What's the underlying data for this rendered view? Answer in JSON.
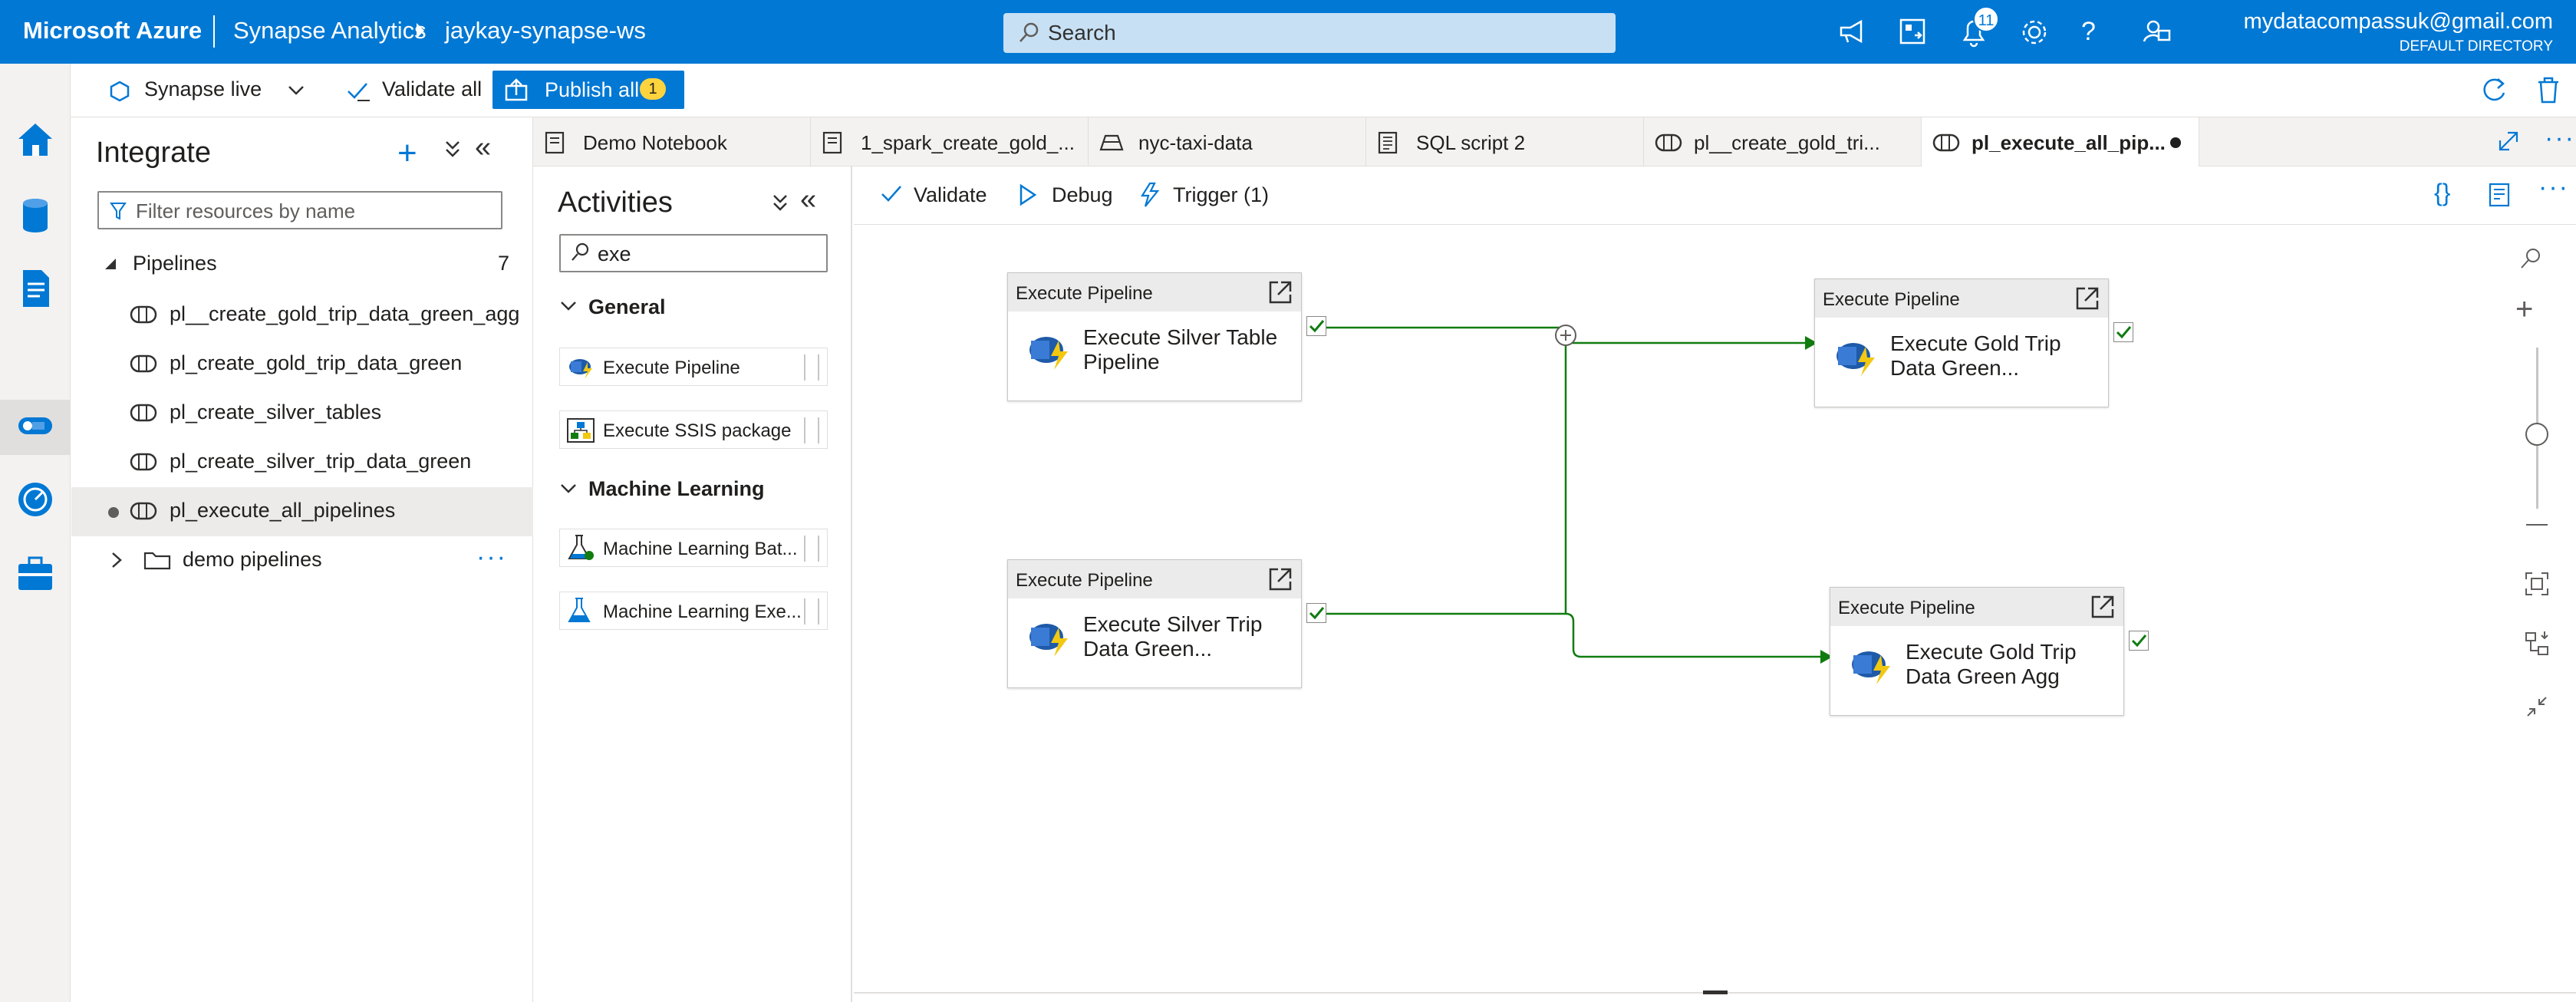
{
  "topbar": {
    "brand": "Microsoft Azure",
    "service": "Synapse Analytics",
    "workspace": "jaykay-synapse-ws",
    "search_placeholder": "Search",
    "notification_count": "11",
    "account_email": "mydatacompassuk@gmail.com",
    "directory": "DEFAULT DIRECTORY"
  },
  "commandbar": {
    "synapse_live": "Synapse live",
    "validate_all": "Validate all",
    "publish_all": "Publish all",
    "publish_count": "1"
  },
  "explorer": {
    "title": "Integrate",
    "filter_placeholder": "Filter resources by name",
    "section": "Pipelines",
    "section_count": "7",
    "pipelines": [
      "pl__create_gold_trip_data_green_agg",
      "pl_create_gold_trip_data_green",
      "pl_create_silver_tables",
      "pl_create_silver_trip_data_green",
      "pl_execute_all_pipelines"
    ],
    "folder": "demo pipelines"
  },
  "tabs": [
    {
      "label": "Demo Notebook",
      "icon": "notebook-icon"
    },
    {
      "label": "1_spark_create_gold_...",
      "icon": "notebook-icon"
    },
    {
      "label": "nyc-taxi-data",
      "icon": "dataset-icon"
    },
    {
      "label": "SQL script 2",
      "icon": "sql-script-icon"
    },
    {
      "label": "pl__create_gold_tri...",
      "icon": "pipeline-icon"
    },
    {
      "label": "pl_execute_all_pip...",
      "icon": "pipeline-icon"
    }
  ],
  "activities": {
    "title": "Activities",
    "search_value": "exe",
    "groups": [
      {
        "name": "General",
        "items": [
          "Execute Pipeline",
          "Execute SSIS package"
        ]
      },
      {
        "name": "Machine Learning",
        "items": [
          "Machine Learning Bat...",
          "Machine Learning Exe..."
        ]
      }
    ]
  },
  "canvas_toolbar": {
    "validate": "Validate",
    "debug": "Debug",
    "trigger": "Trigger (1)"
  },
  "nodes": [
    {
      "type": "Execute Pipeline",
      "name": "Execute Silver Table Pipeline"
    },
    {
      "type": "Execute Pipeline",
      "name": "Execute Silver Trip Data Green..."
    },
    {
      "type": "Execute Pipeline",
      "name": "Execute Gold Trip Data Green..."
    },
    {
      "type": "Execute Pipeline",
      "name": "Execute Gold Trip Data Green Agg"
    }
  ],
  "colors": {
    "brand_blue": "#0078d4",
    "success_green": "#107c10",
    "badge_yellow": "#ffd33d"
  }
}
